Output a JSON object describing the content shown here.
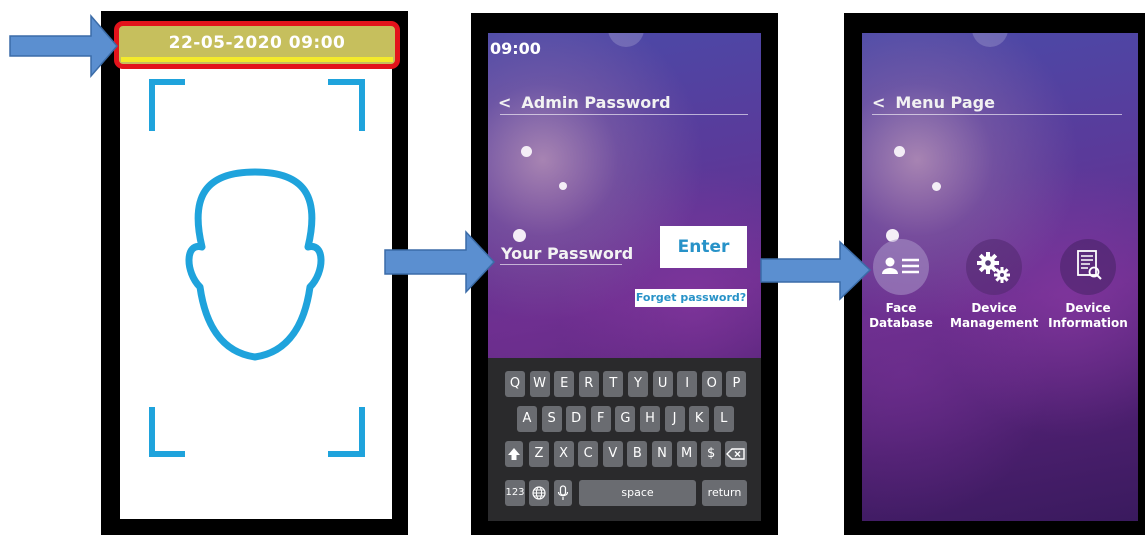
{
  "screen1": {
    "datetime": "22-05-2020 09:00"
  },
  "screen2": {
    "status_time": "09:00",
    "back_glyph": "<",
    "title": "Admin Password",
    "password_label": "Your Password",
    "enter_label": "Enter",
    "forget_label": "Forget password?",
    "keyboard": {
      "row1": [
        "Q",
        "W",
        "E",
        "R",
        "T",
        "Y",
        "U",
        "I",
        "O",
        "P"
      ],
      "row2": [
        "A",
        "S",
        "D",
        "F",
        "G",
        "H",
        "J",
        "K",
        "L"
      ],
      "row3": [
        "Z",
        "X",
        "C",
        "V",
        "B",
        "N",
        "M",
        "$"
      ],
      "shift_icon": "shift-icon",
      "backspace_icon": "backspace-icon",
      "numbers_label": "123",
      "space_label": "space",
      "return_label": "return"
    }
  },
  "screen3": {
    "back_glyph": "<",
    "title": "Menu Page",
    "items": [
      {
        "line1": "Face",
        "line2": "Database",
        "icon": "face-database-icon"
      },
      {
        "line1": "Device",
        "line2": "Management",
        "icon": "gears-icon"
      },
      {
        "line1": "Device",
        "line2": "Information",
        "icon": "document-search-icon"
      }
    ]
  },
  "colors": {
    "accent_blue": "#1fa3dc",
    "arrow_fill": "#5b8fd0",
    "highlight_border": "#e3131b",
    "button_text": "#2792c8"
  }
}
